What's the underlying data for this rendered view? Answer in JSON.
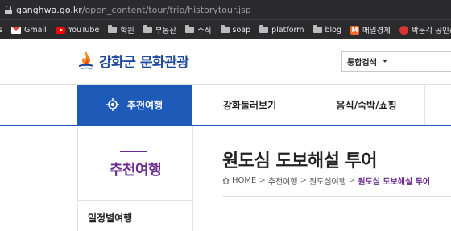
{
  "browser": {
    "url_domain": "ganghwa.go.kr",
    "url_path": "/open_content/tour/trip/historytour.jsp",
    "bookmarks": [
      {
        "label": "s",
        "icon": "folder-icon"
      },
      {
        "label": "Gmail",
        "icon": "gmail-icon"
      },
      {
        "label": "YouTube",
        "icon": "youtube-icon"
      },
      {
        "label": "학원",
        "icon": "folder-icon"
      },
      {
        "label": "부동산",
        "icon": "folder-icon"
      },
      {
        "label": "주식",
        "icon": "folder-icon"
      },
      {
        "label": "soap",
        "icon": "folder-icon"
      },
      {
        "label": "platform",
        "icon": "folder-icon"
      },
      {
        "label": "blog",
        "icon": "folder-icon"
      },
      {
        "label": "매일경제",
        "icon": "maeil-icon"
      },
      {
        "label": "박문각 공인중개",
        "icon": "bakmungak-icon"
      }
    ]
  },
  "header": {
    "logo_text_a": "강화군 ",
    "logo_text_b": "문화관광",
    "search_scope": "통합검색"
  },
  "nav": {
    "items": [
      {
        "label": "추천여행",
        "active": true
      },
      {
        "label": "강화둘러보기",
        "active": false
      },
      {
        "label": "음식/숙박/쇼핑",
        "active": false
      }
    ]
  },
  "sidebar": {
    "title": "추천여행",
    "items": [
      "일정별여행"
    ]
  },
  "content": {
    "title": "원도심 도보해설 투어",
    "breadcrumb": [
      "HOME",
      "추천여행",
      "원도심여행",
      "원도심 도보해설 투어"
    ]
  },
  "colors": {
    "nav_active": "#1e5bb8",
    "accent_purple": "#6a2c91",
    "logo_blue": "#1e4a9b"
  }
}
